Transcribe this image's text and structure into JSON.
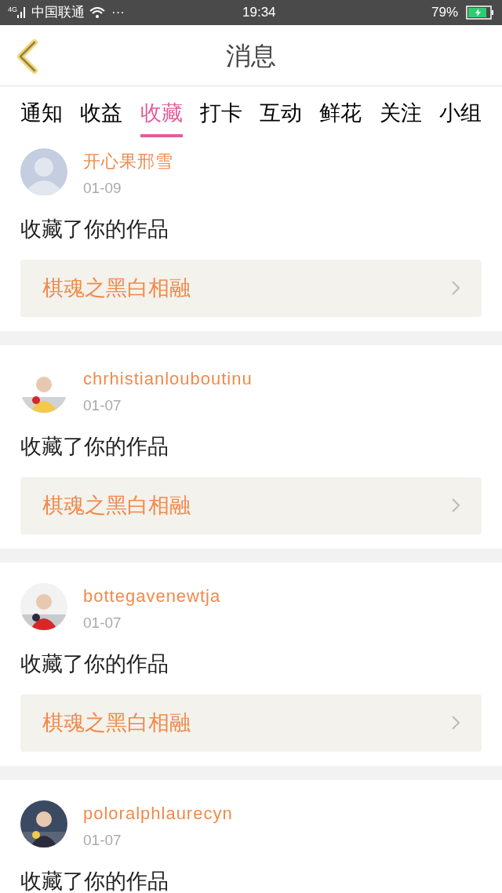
{
  "status_bar": {
    "network": "4G",
    "carrier": "中国联通",
    "more": "···",
    "time": "19:34",
    "battery": "79%"
  },
  "header": {
    "title": "消息"
  },
  "tabs": [
    {
      "label": "通知",
      "selected": false
    },
    {
      "label": "收益",
      "selected": false
    },
    {
      "label": "收藏",
      "selected": true
    },
    {
      "label": "打卡",
      "selected": false
    },
    {
      "label": "互动",
      "selected": false
    },
    {
      "label": "鲜花",
      "selected": false
    },
    {
      "label": "关注",
      "selected": false
    },
    {
      "label": "小组",
      "selected": false
    }
  ],
  "messages": [
    {
      "avatar": {
        "kind": "default"
      },
      "name": "开心果邢雪",
      "date": "01-09",
      "text": "收藏了你的作品",
      "work": "棋魂之黑白相融"
    },
    {
      "name": "chrhistianlouboutinu",
      "date": "01-07",
      "text": "收藏了你的作品",
      "work": "棋魂之黑白相融"
    },
    {
      "name": "bottegavenewtja",
      "date": "01-07",
      "text": "收藏了你的作品",
      "work": "棋魂之黑白相融"
    },
    {
      "name": "poloralphlaurecyn",
      "date": "01-07",
      "text": "收藏了你的作品"
    }
  ]
}
